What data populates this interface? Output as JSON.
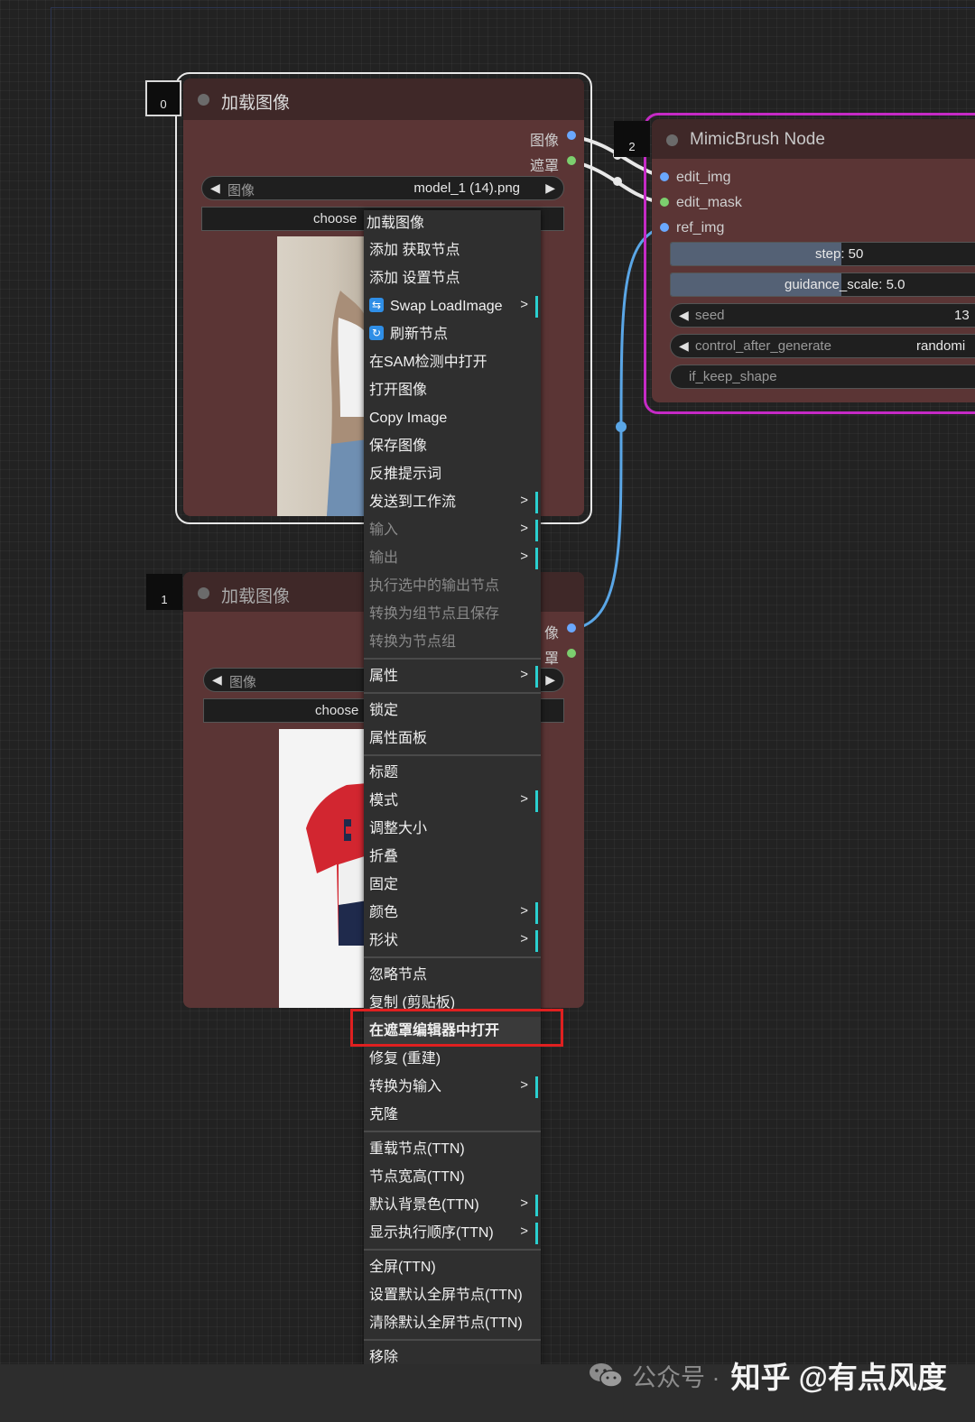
{
  "node0": {
    "id": "0",
    "title": "加载图像",
    "outputs": [
      "图像",
      "遮罩"
    ],
    "image_widget_label": "图像",
    "image_widget_value": "model_1 (14).png",
    "upload_button": "choose"
  },
  "node1": {
    "id": "1",
    "title": "加载图像",
    "outputs": [
      "像",
      "罩"
    ],
    "image_widget_label": "图像",
    "upload_button": "choose"
  },
  "node2": {
    "id": "2",
    "title": "MimicBrush Node",
    "inputs": [
      "edit_img",
      "edit_mask",
      "ref_img"
    ],
    "step_label": "step: 50",
    "guidance_label": "guidance_scale: 5.0",
    "seed_label": "seed",
    "seed_value": "13",
    "control_label": "control_after_generate",
    "control_value": "randomi",
    "keep_shape_label": "if_keep_shape",
    "step_fraction": 0.5,
    "guidance_fraction": 0.5
  },
  "menu": {
    "title": "加载图像",
    "items": [
      {
        "label": "添加 获取节点"
      },
      {
        "label": "添加 设置节点"
      },
      {
        "label": "Swap LoadImage",
        "icon": "swap-icon",
        "submenu": true
      },
      {
        "label": "刷新节点",
        "icon": "refresh-icon"
      },
      {
        "label": "在SAM检测中打开"
      },
      {
        "label": "打开图像"
      },
      {
        "label": "Copy Image"
      },
      {
        "label": "保存图像"
      },
      {
        "label": "反推提示词"
      },
      {
        "label": "发送到工作流",
        "submenu": true
      },
      {
        "label": "输入",
        "submenu": true,
        "disabled": true
      },
      {
        "label": "输出",
        "submenu": true,
        "disabled": true
      },
      {
        "label": "执行选中的输出节点",
        "disabled": true
      },
      {
        "label": "转换为组节点且保存",
        "disabled": true
      },
      {
        "label": "转换为节点组",
        "disabled": true
      },
      {
        "label": "属性",
        "submenu": true,
        "sep_before": true
      },
      {
        "label": "锁定",
        "sep_before": true
      },
      {
        "label": "属性面板"
      },
      {
        "label": "标题",
        "sep_before": true
      },
      {
        "label": "模式",
        "submenu": true
      },
      {
        "label": "调整大小"
      },
      {
        "label": "折叠"
      },
      {
        "label": "固定"
      },
      {
        "label": "颜色",
        "submenu": true
      },
      {
        "label": "形状",
        "submenu": true
      },
      {
        "label": "忽略节点",
        "sep_before": true
      },
      {
        "label": "复制 (剪贴板)"
      },
      {
        "label": "在遮罩编辑器中打开",
        "highlighted": true
      },
      {
        "label": "修复 (重建)"
      },
      {
        "label": "转换为输入",
        "submenu": true
      },
      {
        "label": "克隆"
      },
      {
        "label": "重载节点(TTN)",
        "sep_before": true
      },
      {
        "label": "节点宽高(TTN)"
      },
      {
        "label": "默认背景色(TTN)",
        "submenu": true
      },
      {
        "label": "显示执行顺序(TTN)",
        "submenu": true
      },
      {
        "label": "全屏(TTN)",
        "sep_before": true
      },
      {
        "label": "设置默认全屏节点(TTN)"
      },
      {
        "label": "清除默认全屏节点(TTN)"
      },
      {
        "label": "移除",
        "sep_before": true
      }
    ],
    "submenu_glyph": ">"
  },
  "watermark": {
    "source": "公众号 ·",
    "author": "知乎 @有点风度"
  },
  "colors": {
    "node_body": "#5b3535",
    "node_title": "#3f2828",
    "selected_outline": "#c52ac5",
    "highlight_box": "#e02020",
    "wire_blue": "#5aa6e6"
  }
}
